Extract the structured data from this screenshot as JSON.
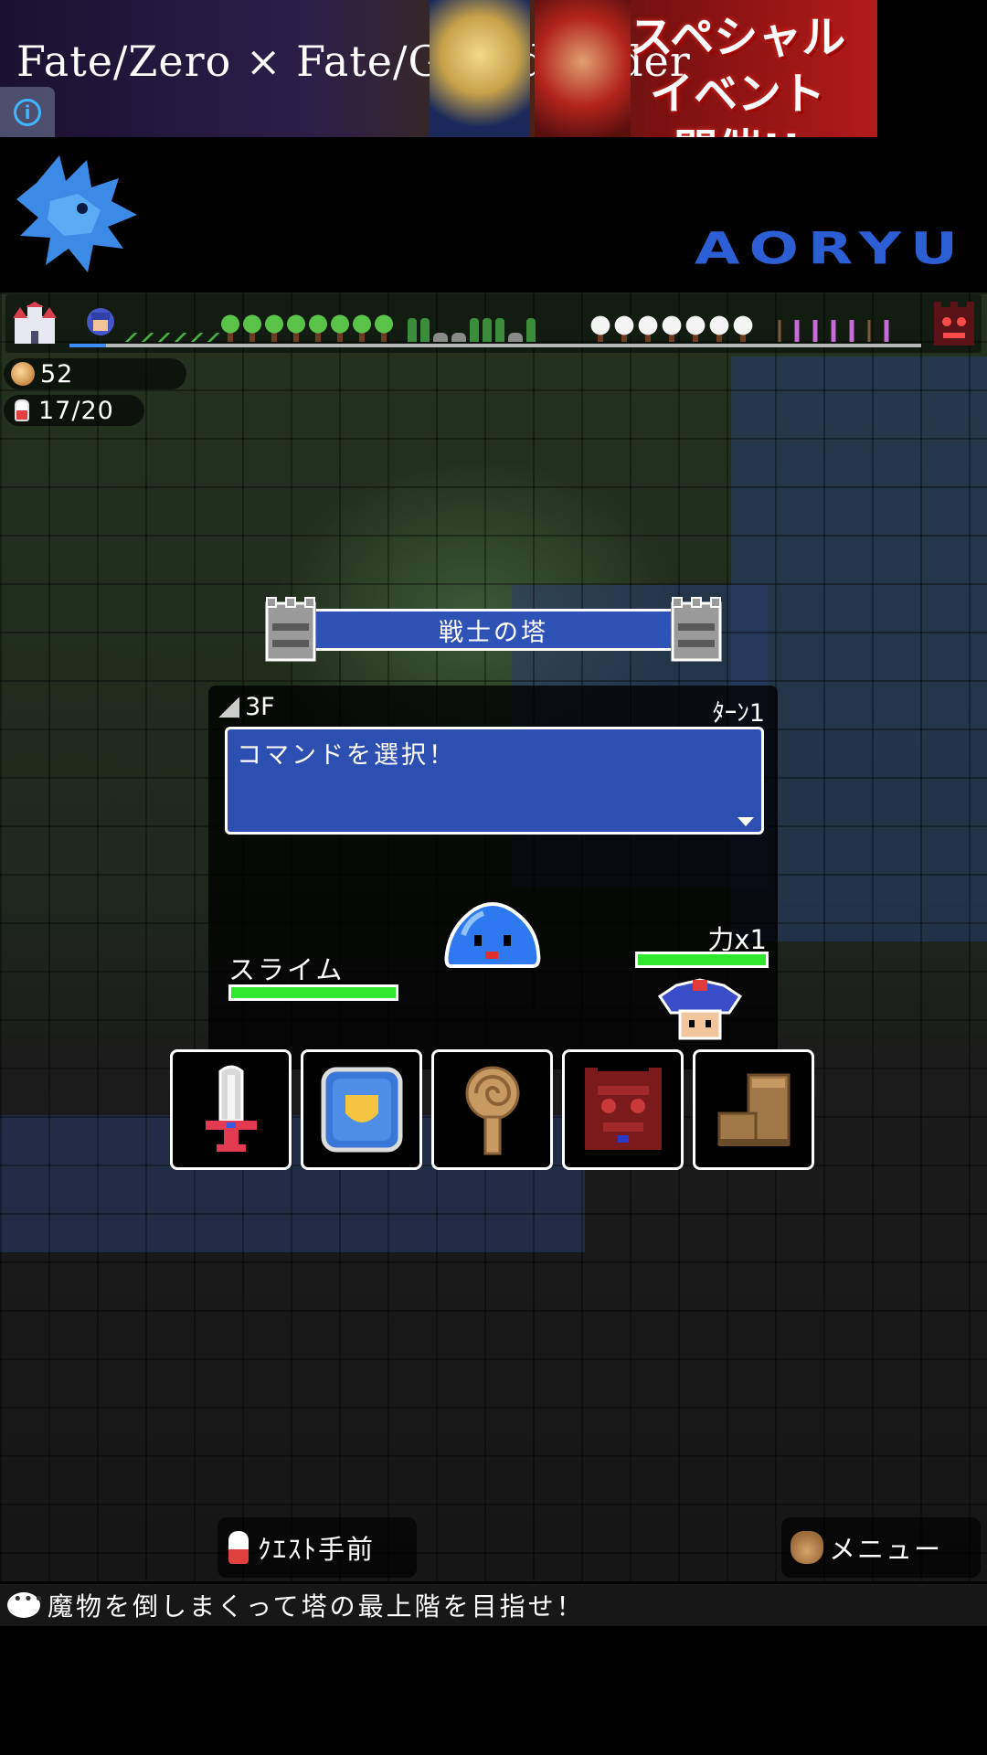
{
  "ad": {
    "left_text": "Fate/Zero × Fate/Grand Order",
    "right_text_line1": "スペシャルイベント",
    "right_text_line2": "開催!!"
  },
  "header": {
    "brand": "AORYU"
  },
  "counters": {
    "coins": "52",
    "stamina": "17/20"
  },
  "tower": {
    "name": "戦士の塔"
  },
  "battle": {
    "floor": "3F",
    "turn": "ﾀｰﾝ1",
    "message": "コマンドを選択！",
    "enemy_name": "スライム",
    "enemy_hp_fraction": 1.0,
    "power_label": "力x1",
    "player_hp_fraction": 1.0
  },
  "commands": [
    {
      "name": "attack",
      "icon": "sword-icon"
    },
    {
      "name": "defend",
      "icon": "shield-icon"
    },
    {
      "name": "magic",
      "icon": "staff-icon"
    },
    {
      "name": "special",
      "icon": "demon-icon"
    },
    {
      "name": "escape",
      "icon": "boot-icon"
    }
  ],
  "bottom": {
    "quest_label": "ｸｴｽﾄ手前",
    "menu_label": "メニュー"
  },
  "tip": "魔物を倒しまくって塔の最上階を目指せ！",
  "colors": {
    "panel_blue": "#2f52b7",
    "hp_green": "#30e830",
    "brand_blue": "#2c5fd3"
  }
}
